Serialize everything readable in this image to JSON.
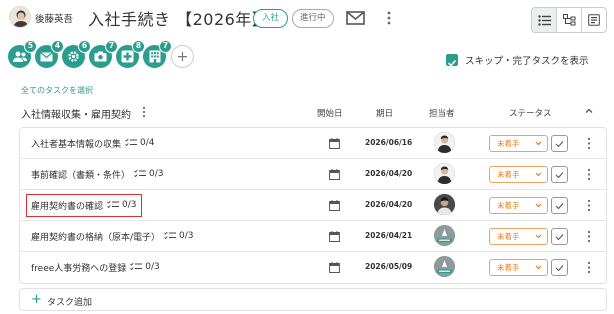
{
  "header": {
    "user_name": "後藤英吾",
    "title": "入社手続き 【2026年】",
    "type_pill": "入社",
    "progress_pill": "進行中",
    "mail_icon": "mail-icon",
    "views": [
      "list-view-icon",
      "tree-view-icon",
      "board-view-icon"
    ]
  },
  "categories": [
    {
      "icon": "people-icon",
      "count": "5"
    },
    {
      "icon": "mail-icon",
      "count": "4"
    },
    {
      "icon": "gear-icon",
      "count": "6"
    },
    {
      "icon": "camera-icon",
      "count": "7"
    },
    {
      "icon": "medical-icon",
      "count": "8"
    },
    {
      "icon": "building-icon",
      "count": "7"
    }
  ],
  "skip_toggle": {
    "label": "スキップ・完了タスクを表示",
    "checked": true
  },
  "select_all": "全てのタスクを選択",
  "section": {
    "title": "入社情報収集・雇用契約",
    "columns": {
      "start": "開始日",
      "due": "期日",
      "assignee": "担当者",
      "status": "ステータス"
    }
  },
  "tasks": [
    {
      "name": "入社者基本情報の収集",
      "checks": "0/4",
      "due": "2026/06/16",
      "assignee": "photo-a",
      "status": "未着手"
    },
    {
      "name": "事前確認（書類・条件）",
      "checks": "0/3",
      "due": "2026/04/20",
      "assignee": "photo-b",
      "status": "未着手"
    },
    {
      "name": "雇用契約書の確認",
      "checks": "0/3",
      "due": "2026/04/20",
      "assignee": "photo-c",
      "status": "未着手"
    },
    {
      "name": "雇用契約書の格納（原本/電子）",
      "checks": "0/3",
      "due": "2026/04/21",
      "assignee": "default",
      "status": "未着手"
    },
    {
      "name": "freee人事労務への登録",
      "checks": "0/3",
      "due": "2026/05/09",
      "assignee": "default",
      "status": "未着手"
    }
  ],
  "add_task": "タスク追加",
  "colors": {
    "accent": "#2a9d8f",
    "status": "#e67e22",
    "highlight": "#d9302c"
  }
}
